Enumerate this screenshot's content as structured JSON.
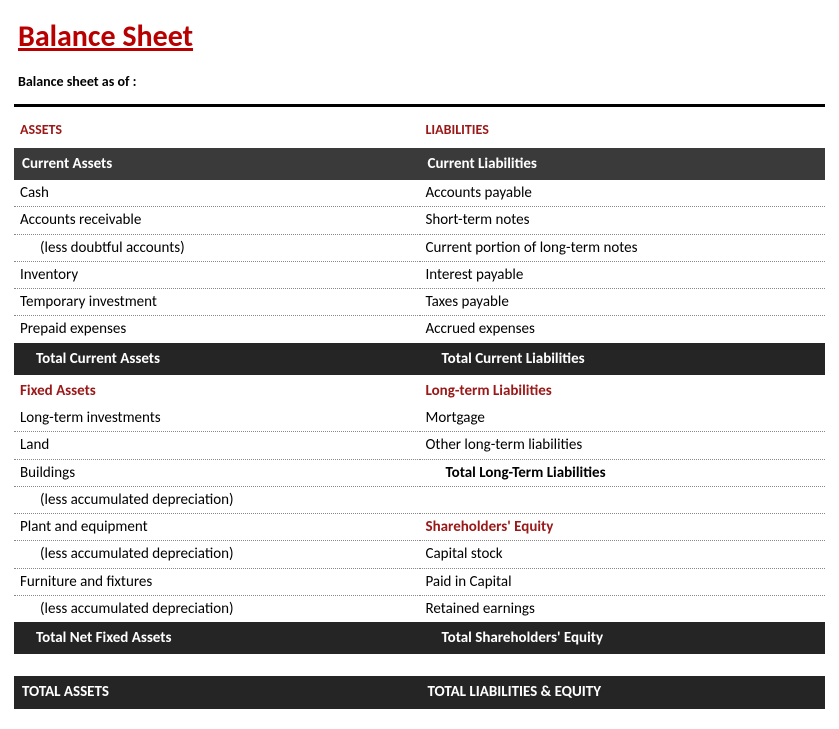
{
  "title": "Balance Sheet",
  "asof_label": "Balance sheet as of :",
  "assets": {
    "heading": "ASSETS",
    "current": {
      "label": "Current Assets",
      "rows": [
        {
          "label": "Cash"
        },
        {
          "label": "Accounts receivable"
        },
        {
          "label": "(less doubtful accounts)",
          "indent": true
        },
        {
          "label": "Inventory"
        },
        {
          "label": "Temporary investment"
        },
        {
          "label": "Prepaid expenses"
        }
      ],
      "total_label": "Total Current Assets"
    },
    "fixed": {
      "label": "Fixed Assets",
      "rows": [
        {
          "label": "Long-term investments"
        },
        {
          "label": "Land"
        },
        {
          "label": "Buildings"
        },
        {
          "label": "(less accumulated depreciation)",
          "indent": true
        },
        {
          "label": "Plant and equipment"
        },
        {
          "label": "(less accumulated depreciation)",
          "indent": true
        },
        {
          "label": "Furniture and fixtures"
        },
        {
          "label": "(less accumulated depreciation)",
          "indent": true
        }
      ],
      "total_label": "Total Net Fixed Assets"
    },
    "grand_total_label": "TOTAL ASSETS"
  },
  "liabilities": {
    "heading": "LIABILITIES",
    "current": {
      "label": "Current Liabilities",
      "rows": [
        {
          "label": "Accounts payable"
        },
        {
          "label": "Short-term notes"
        },
        {
          "label": "Current portion of long-term notes"
        },
        {
          "label": "Interest payable"
        },
        {
          "label": "Taxes payable"
        },
        {
          "label": "Accrued expenses"
        }
      ],
      "total_label": "Total Current Liabilities"
    },
    "longterm": {
      "label": "Long-term Liabilities",
      "rows": [
        {
          "label": "Mortgage"
        },
        {
          "label": "Other long-term liabilities"
        }
      ],
      "total_label": "Total Long-Term Liabilities"
    },
    "equity": {
      "label": "Shareholders' Equity",
      "rows": [
        {
          "label": "Capital stock"
        },
        {
          "label": "Paid in Capital"
        },
        {
          "label": "Retained earnings"
        }
      ],
      "total_label": "Total Shareholders' Equity"
    },
    "grand_total_label": "TOTAL LIABILITIES & EQUITY"
  }
}
